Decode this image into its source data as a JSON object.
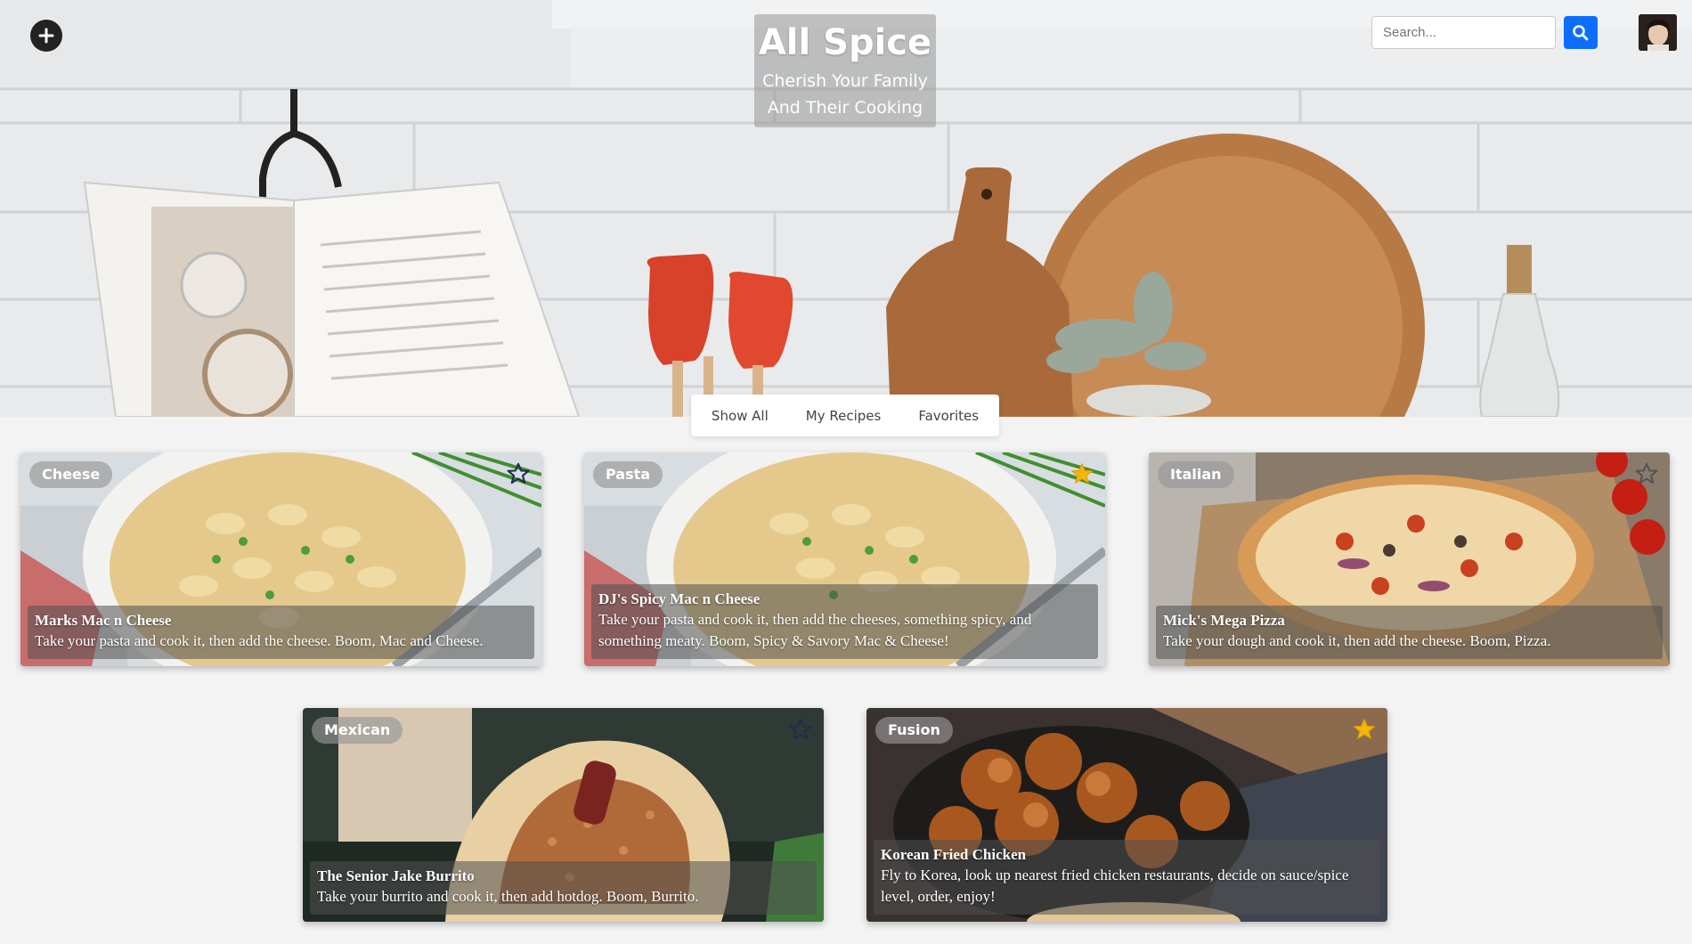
{
  "header": {
    "brand_title": "All Spice",
    "brand_subtitle_line1": "Cherish Your Family",
    "brand_subtitle_line2": "And Their Cooking",
    "search_placeholder": "Search..."
  },
  "filters": {
    "tabs": [
      {
        "label": "Show All"
      },
      {
        "label": "My Recipes"
      },
      {
        "label": "Favorites"
      }
    ]
  },
  "recipes": [
    {
      "category": "Cheese",
      "title": "Marks Mac n Cheese",
      "description": "Take your pasta and cook it, then add the cheese. Boom, Mac and Cheese.",
      "favorited": false
    },
    {
      "category": "Pasta",
      "title": "DJ's Spicy Mac n Cheese",
      "description": "Take your pasta and cook it, then add the cheeses, something spicy, and something meaty. Boom, Spicy & Savory Mac & Cheese!",
      "favorited": true
    },
    {
      "category": "Italian",
      "title": "Mick's Mega Pizza",
      "description": "Take your dough and cook it, then add the cheese. Boom, Pizza.",
      "favorited": false
    },
    {
      "category": "Mexican",
      "title": "The Senior Jake Burrito",
      "description": "Take your burrito and cook it, then add hotdog. Boom, Burrito.",
      "favorited": false
    },
    {
      "category": "Fusion",
      "title": "Korean Fried Chicken",
      "description": "Fly to Korea, look up nearest fried chicken restaurants, decide on sauce/spice level, order, enjoy!",
      "favorited": true
    }
  ],
  "colors": {
    "accent": "#0d6efd",
    "star_filled": "#f5b50a",
    "star_outline": "#1f2d4a"
  }
}
